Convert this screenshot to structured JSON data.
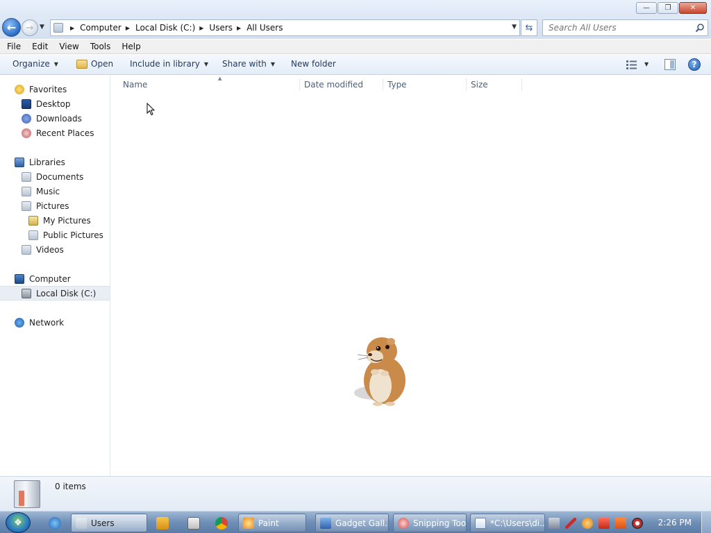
{
  "window": {
    "minimize_glyph": "—",
    "maximize_glyph": "❐",
    "close_glyph": "✕"
  },
  "address": {
    "back_glyph": "←",
    "forward_glyph": "→",
    "breadcrumbs": [
      "Computer",
      "Local Disk (C:)",
      "Users",
      "All Users"
    ]
  },
  "search": {
    "placeholder": "Search All Users"
  },
  "menu": [
    "File",
    "Edit",
    "View",
    "Tools",
    "Help"
  ],
  "toolbar": {
    "organize": "Organize",
    "open": "Open",
    "include_in_library": "Include in library",
    "share_with": "Share with",
    "new_folder": "New folder",
    "help_glyph": "?"
  },
  "navigation": {
    "favorites": "Favorites",
    "desktop": "Desktop",
    "downloads": "Downloads",
    "recent_places": "Recent Places",
    "libraries": "Libraries",
    "documents": "Documents",
    "music": "Music",
    "pictures": "Pictures",
    "my_pictures": "My Pictures",
    "public_pictures": "Public Pictures",
    "videos": "Videos",
    "computer": "Computer",
    "local_disk": "Local Disk (C:)",
    "network": "Network"
  },
  "columns": {
    "name": "Name",
    "date_modified": "Date modified",
    "type": "Type",
    "size": "Size"
  },
  "details": {
    "item_count": "0 items"
  },
  "taskbar": {
    "users": "Users",
    "paint": "Paint",
    "gadget_gallery": "Gadget Gall...",
    "snipping_tool": "Snipping Tool",
    "notepad": "*C:\\Users\\di...",
    "clock": "2:26 PM"
  },
  "colors": {
    "accent": "#2b6cc4",
    "nav_selected": "#e9eef4",
    "taskbar": "#6f8fb7"
  }
}
